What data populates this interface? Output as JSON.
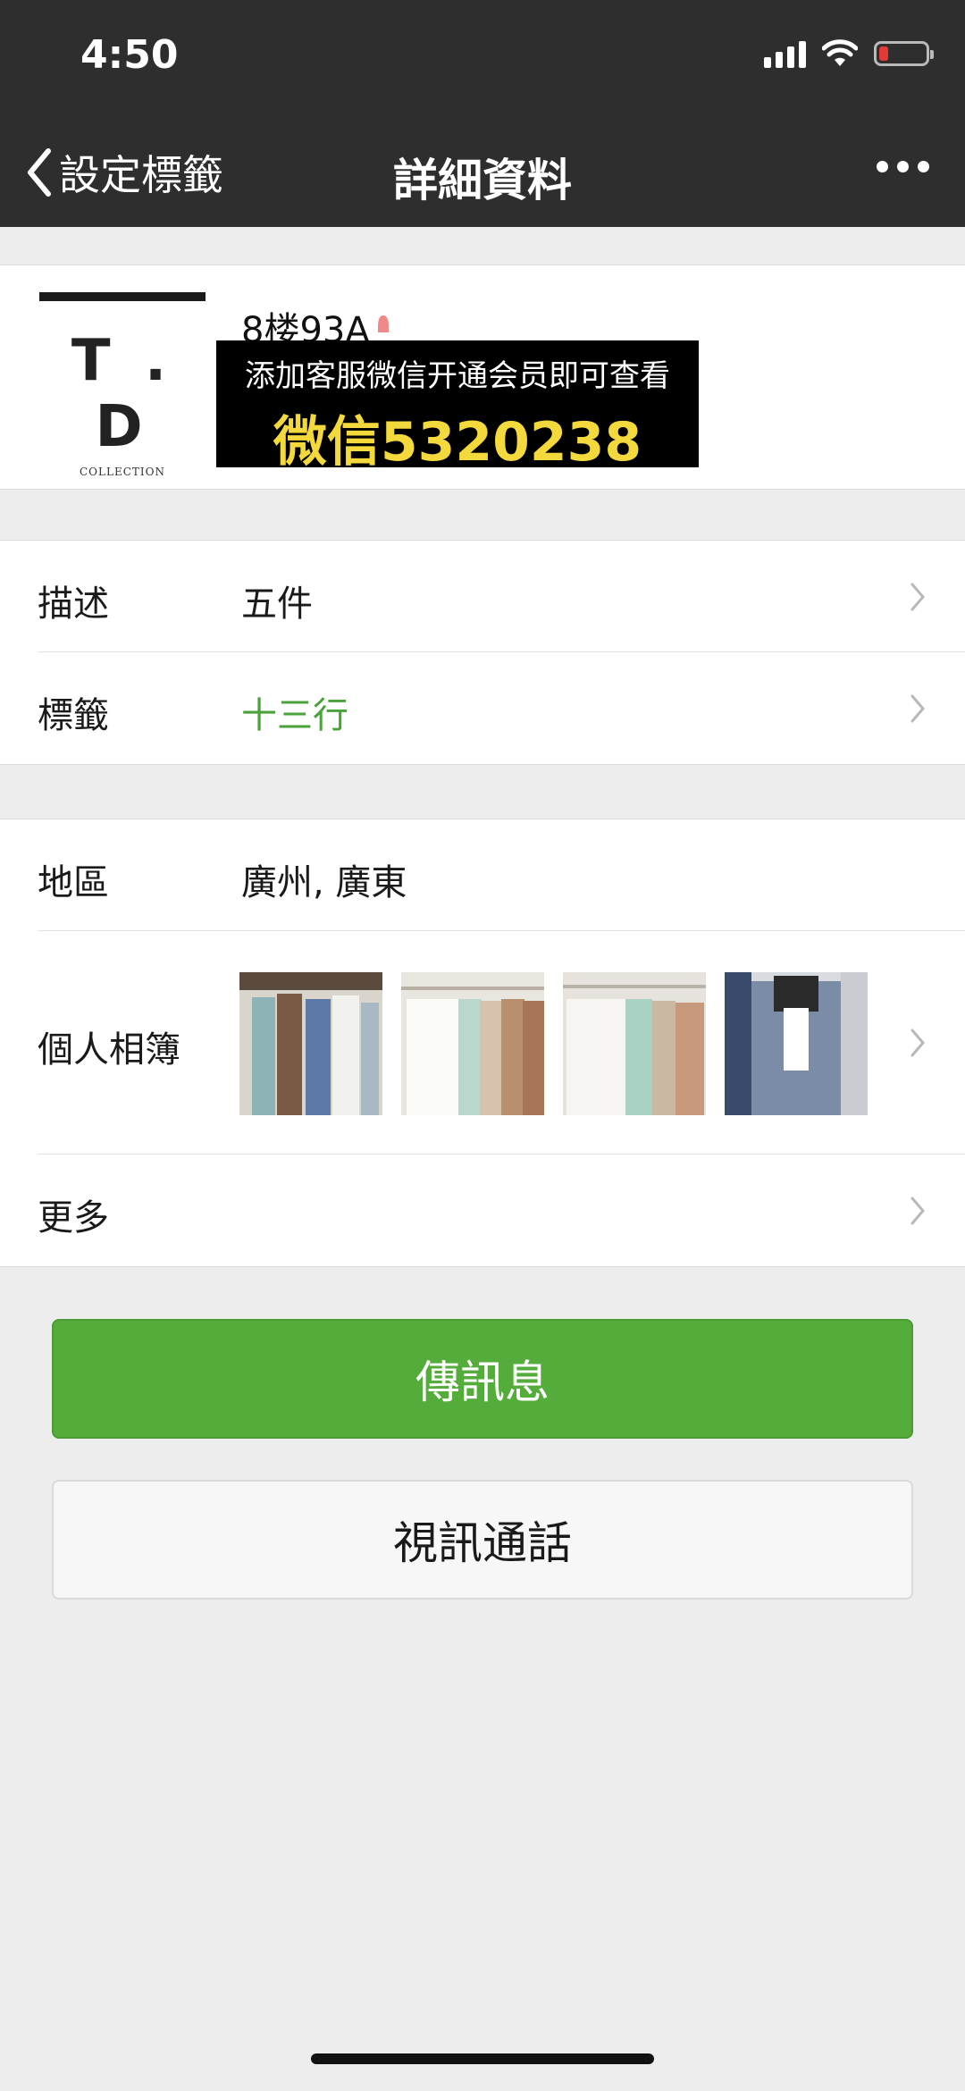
{
  "status_bar": {
    "time": "4:50"
  },
  "nav": {
    "back_label": "設定標籤",
    "title": "詳細資料"
  },
  "profile": {
    "avatar_text": "T . D",
    "avatar_subtext": "COLLECTION",
    "name": "8楼93A",
    "promo_line1": "添加客服微信开通会员即可查看",
    "promo_line2": "微信5320238"
  },
  "rows": {
    "description": {
      "label": "描述",
      "value": "五件"
    },
    "tags": {
      "label": "標籤",
      "value": "十三行"
    },
    "region": {
      "label": "地區",
      "value": "廣州, 廣東"
    },
    "album": {
      "label": "個人相簿"
    },
    "more": {
      "label": "更多"
    }
  },
  "buttons": {
    "message": "傳訊息",
    "video_call": "視訊通話"
  },
  "colors": {
    "nav_bg": "#2e2e2e",
    "accent_green": "#54ad3a",
    "tag_green": "#4aa23a",
    "promo_yellow": "#f3d93b"
  }
}
